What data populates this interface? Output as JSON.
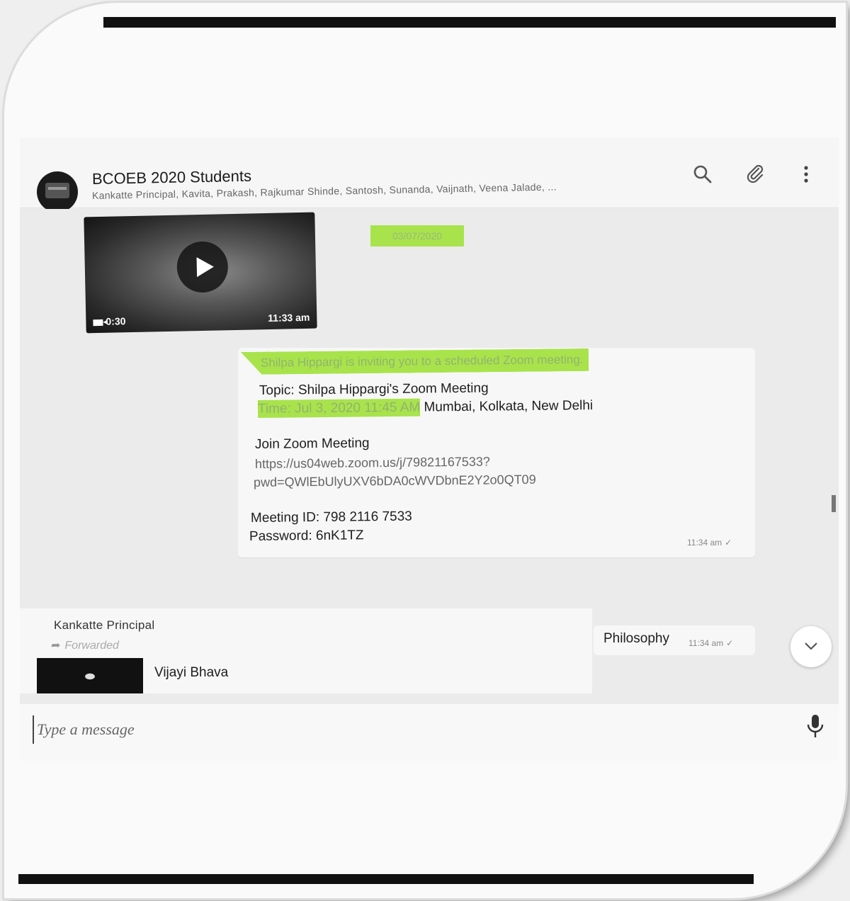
{
  "header": {
    "group_name": "BCOEB 2020 Students",
    "participants": "Kankatte Principal, Kavita, Prakash, Rajkumar Shinde, Santosh, Sunanda, Vaijnath, Veena Jalade, ...",
    "icons": [
      "search-icon",
      "attach-icon",
      "menu-icon"
    ]
  },
  "video_message": {
    "duration": "0:30",
    "time": "11:33 am",
    "icons": [
      "play-icon",
      "video-camera-icon"
    ]
  },
  "date_chip": "03/07/2020",
  "zoom_message": {
    "invite": "Shilpa Hippargi is inviting you to a scheduled Zoom meeting.",
    "topic": "Topic: Shilpa Hippargi's Zoom Meeting",
    "time_highlighted": "Time: Jul 3, 2020 11:45 AM",
    "time_rest": " Mumbai, Kolkata, New Delhi",
    "join": "Join Zoom Meeting",
    "link_line1": "https://us04web.zoom.us/j/79821167533?",
    "link_line2": "pwd=QWlEbUlyUXV6bDA0cWVDbnE2Y2o0QT09",
    "meeting_id": "Meeting ID: 798 2116 7533",
    "password": "Password: 6nK1TZ",
    "time": "11:34 am",
    "tick": "✓"
  },
  "philosophy_message": {
    "text": "Philosophy",
    "time": "11:34 am",
    "tick": "✓"
  },
  "incoming_message": {
    "sender": "Kankatte Principal",
    "forwarded_label": "Forwarded",
    "title": "Vijayi Bhava"
  },
  "composer": {
    "placeholder": "Type a message"
  },
  "colors": {
    "highlight": "#a8e34c",
    "background": "#ebebeb",
    "bubble": "#f7f7f7"
  }
}
